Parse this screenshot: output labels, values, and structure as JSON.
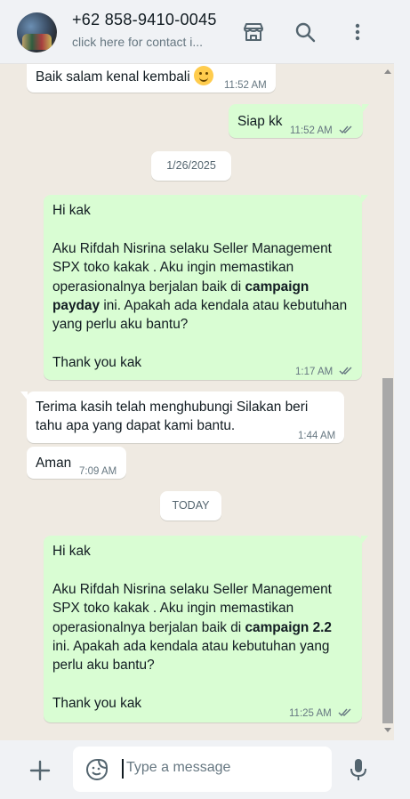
{
  "header": {
    "contact_name": "+62 858-9410-0045",
    "contact_subtitle": "click here for contact i...",
    "icons": [
      "store-icon",
      "search-icon",
      "more-options-icon"
    ]
  },
  "messages": [
    {
      "dir": "in",
      "text": "Baik salam kenal kembali",
      "emoji": "smiling-face-emoji",
      "time": "11:52 AM"
    },
    {
      "dir": "out",
      "text": "Siap kk",
      "time": "11:52 AM",
      "status": "read"
    },
    {
      "dir": "date",
      "text": "1/26/2025"
    },
    {
      "dir": "out",
      "lines": [
        "Hi kak",
        "",
        "Aku Rifdah Nisrina selaku Seller Management",
        "SPX toko kakak . Aku ingin memastikan",
        "operasionalnya berjalan baik di ",
        "payday",
        " ini. Apakah ada kendala atau kebutuhan",
        "yang perlu aku bantu?",
        "",
        "Thank you kak"
      ],
      "bold1": "campaign",
      "time": "1:17 AM",
      "status": "read"
    },
    {
      "dir": "in",
      "text": "Terima kasih telah menghubungi Silakan beri tahu apa yang dapat kami bantu.",
      "time": "1:44 AM"
    },
    {
      "dir": "in",
      "text": "Aman",
      "time": "7:09 AM"
    },
    {
      "dir": "date",
      "text": "TODAY"
    },
    {
      "dir": "out",
      "lines": [
        "Hi kak",
        "Aku Rifdah Nisrina selaku Seller Management",
        "SPX toko kakak . Aku ingin memastikan",
        "operasionalnya berjalan baik di ",
        "campaign 2.2",
        "ini. Apakah ada kendala atau kebutuhan yang",
        "perlu aku bantu?",
        "Thank you kak"
      ],
      "time": "11:25 AM",
      "status": "read"
    }
  ],
  "m4": {
    "l1": "Hi kak",
    "l2": "Aku Rifdah Nisrina selaku Seller Management",
    "l3": "SPX toko kakak . Aku ingin memastikan",
    "l4a": "operasionalnya berjalan baik di ",
    "l4b": "campaign",
    "l5b": "payday",
    "l5c": " ini. Apakah ada kendala atau kebutuhan",
    "l6": "yang perlu aku bantu?",
    "l7": "Thank you kak"
  },
  "m5": {
    "l1": "Terima kasih telah menghubungi Silakan beri",
    "l2": "tahu apa yang dapat kami bantu."
  },
  "m8": {
    "l1": "Hi kak",
    "l2": "Aku Rifdah Nisrina selaku Seller Management",
    "l3": "SPX toko kakak . Aku ingin memastikan",
    "l4a": "operasionalnya berjalan baik di ",
    "l4b": "campaign 2.2",
    "l5": "ini. Apakah ada kendala atau kebutuhan yang",
    "l6": "perlu aku bantu?",
    "l7": "Thank you kak"
  },
  "composer": {
    "placeholder": "Type a message",
    "value": ""
  },
  "colors": {
    "incoming_bubble": "#ffffff",
    "outgoing_bubble": "#d9fdd3",
    "chat_background": "#efeae2",
    "header_background": "#f0f2f5"
  }
}
